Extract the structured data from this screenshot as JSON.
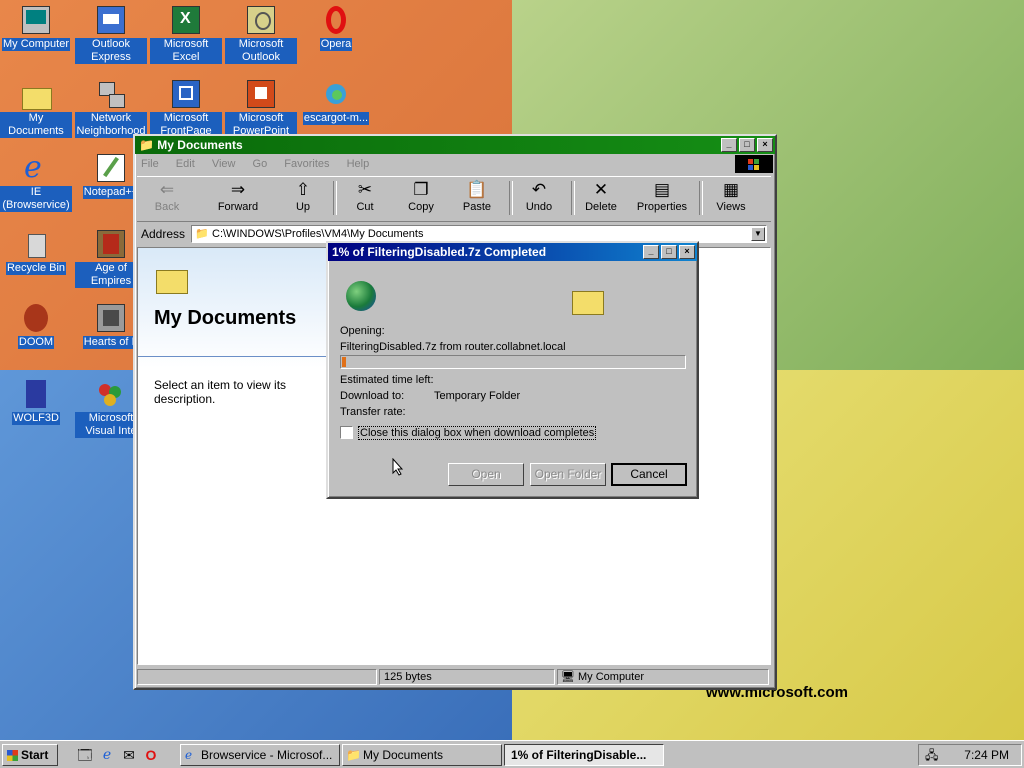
{
  "desktop": {
    "website": "www.microsoft.com",
    "icons": [
      {
        "label": "My Computer",
        "icon": "computer-icon"
      },
      {
        "label": "Outlook Express",
        "icon": "outlook-express-icon"
      },
      {
        "label": "Microsoft Excel",
        "icon": "excel-icon"
      },
      {
        "label": "Microsoft Outlook",
        "icon": "outlook-icon"
      },
      {
        "label": "Opera",
        "icon": "opera-icon"
      },
      {
        "label": "My Documents",
        "icon": "folder-icon"
      },
      {
        "label": "Network Neighborhood",
        "icon": "network-icon"
      },
      {
        "label": "Microsoft FrontPage",
        "icon": "frontpage-icon"
      },
      {
        "label": "Microsoft PowerPoint",
        "icon": "powerpoint-icon"
      },
      {
        "label": "escargot-m...",
        "icon": "escargot-icon"
      },
      {
        "label": "IE (Browservice)",
        "icon": "ie-icon"
      },
      {
        "label": "Notepad++",
        "icon": "notepad-icon"
      },
      {
        "label": "Recycle Bin",
        "icon": "recycle-bin-icon"
      },
      {
        "label": "Age of Empires",
        "icon": "age-of-empires-icon"
      },
      {
        "label": "DOOM",
        "icon": "doom-icon"
      },
      {
        "label": "Hearts of Ir",
        "icon": "hearts-of-iron-icon"
      },
      {
        "label": "WOLF3D",
        "icon": "wolf3d-icon"
      },
      {
        "label": "Microsoft Visual Inte",
        "icon": "visual-interdev-icon"
      }
    ]
  },
  "explorer": {
    "title": "My Documents",
    "menu": [
      "File",
      "Edit",
      "View",
      "Go",
      "Favorites",
      "Help"
    ],
    "toolbar": [
      {
        "label": "Back",
        "icon": "back-arrow-icon"
      },
      {
        "label": "Forward",
        "icon": "forward-arrow-icon"
      },
      {
        "label": "Up",
        "icon": "up-folder-icon"
      },
      {
        "label": "Cut",
        "icon": "scissors-icon"
      },
      {
        "label": "Copy",
        "icon": "copy-icon"
      },
      {
        "label": "Paste",
        "icon": "paste-icon"
      },
      {
        "label": "Undo",
        "icon": "undo-icon"
      },
      {
        "label": "Delete",
        "icon": "delete-icon"
      },
      {
        "label": "Properties",
        "icon": "properties-icon"
      },
      {
        "label": "Views",
        "icon": "views-icon"
      }
    ],
    "address_label": "Address",
    "address": "C:\\WINDOWS\\Profiles\\VM4\\My Documents",
    "panel_title": "My Documents",
    "panel_desc": "Select an item to view its description.",
    "status_size": "125 bytes",
    "status_zone": "My Computer"
  },
  "download": {
    "title": "1% of FilteringDisabled.7z Completed",
    "opening_label": "Opening:",
    "file_line": "FilteringDisabled.7z from router.collabnet.local",
    "progress": 0.01,
    "time_left_label": "Estimated time left:",
    "download_to_label": "Download to:",
    "download_to_value": "Temporary Folder",
    "transfer_rate_label": "Transfer rate:",
    "close_checkbox": "Close this dialog box when download completes",
    "btn_open": "Open",
    "btn_open_folder": "Open Folder",
    "btn_cancel": "Cancel"
  },
  "taskbar": {
    "start": "Start",
    "tasks": [
      "Browservice - Microsof...",
      "My Documents",
      "1% of FilteringDisable..."
    ],
    "clock": "7:24 PM"
  }
}
